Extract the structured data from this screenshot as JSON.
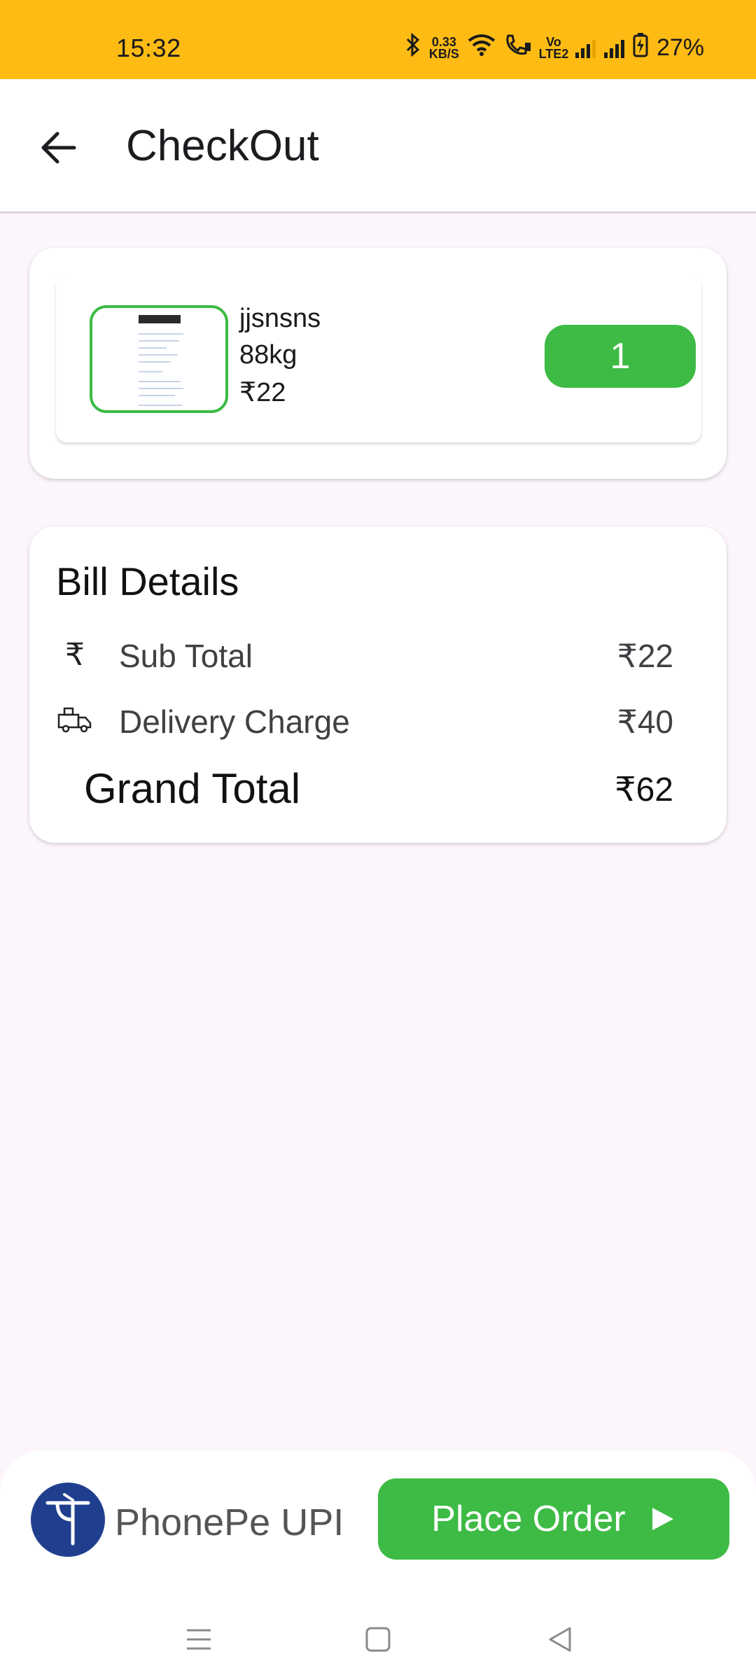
{
  "status_bar": {
    "time": "15:32",
    "net_speed_value": "0.33",
    "net_speed_unit": "KB/S",
    "volte_label": "Vo LTE2",
    "battery": "27%",
    "background_color": "#fdbb14"
  },
  "app_bar": {
    "title": "CheckOut",
    "back_icon": "arrow-left-icon"
  },
  "cart": {
    "items": [
      {
        "name": "jjsnsns",
        "weight": "88kg",
        "price": "₹22",
        "quantity": "1"
      }
    ],
    "accent_color": "#3dbb45"
  },
  "bill": {
    "title": "Bill Details",
    "rows": [
      {
        "icon": "rupee-icon",
        "label": "Sub Total",
        "value": "₹22"
      },
      {
        "icon": "delivery-truck-icon",
        "label": "Delivery Charge",
        "value": "₹40"
      }
    ],
    "grand_total_label": "Grand Total",
    "grand_total_value": "₹62"
  },
  "payment": {
    "method_label": "PhonePe UPI",
    "logo_glyph": "पे",
    "logo_color": "#1f3f8e",
    "place_order_label": "Place Order",
    "place_order_icon": "play-arrow-icon"
  },
  "nav": {
    "items": [
      "menu-icon",
      "home-square-icon",
      "back-triangle-icon"
    ]
  }
}
